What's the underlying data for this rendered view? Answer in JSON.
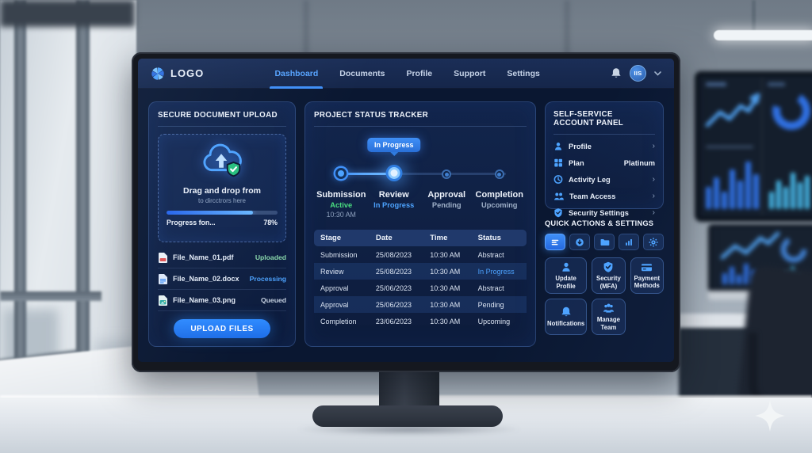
{
  "colors": {
    "accent": "#3f8ff7",
    "accent2": "#7cc4ff",
    "green": "#2ecc8f",
    "panel": "#0e1f40",
    "panelBorder": "#3a5b94",
    "screenbg": "#0a1731",
    "navbg": "#16284e",
    "text": "#eef3fb",
    "muted": "#93a7c4",
    "rowAlt": "#1a3160",
    "stUploaded": "#8ad8ac",
    "stProcessing": "#4da3ff",
    "stQueued": "#c7d2e2"
  },
  "nav": {
    "logo": "LOGO",
    "items": [
      {
        "label": "Dashboard",
        "active": true
      },
      {
        "label": "Documents",
        "active": false
      },
      {
        "label": "Profile",
        "active": false
      },
      {
        "label": "Support",
        "active": false
      },
      {
        "label": "Settings",
        "active": false
      }
    ],
    "avatar": "IIS"
  },
  "upload": {
    "title": "SECURE DOCUMENT UPLOAD",
    "dropzone_title": "Drag and drop from",
    "dropzone_subtitle": "to dircctrors here",
    "progress_label": "Progress fon...",
    "progress_percent": "78%",
    "progress_value": 78,
    "files": [
      {
        "name": "File_Name_01.pdf",
        "status": "Uploaded",
        "type": "pdf",
        "icon": "pdf-file-icon"
      },
      {
        "name": "File_Name_02.docx",
        "status": "Processing",
        "type": "docx",
        "icon": "docx-file-icon"
      },
      {
        "name": "File_Name_03.png",
        "status": "Queued",
        "type": "png",
        "icon": "png-file-icon"
      }
    ],
    "button": "UPLOAD FILES"
  },
  "tracker": {
    "title": "PROJECT STATUS TRACKER",
    "tooltip": "In Progress",
    "steps": [
      {
        "title": "Submission",
        "status": "Active",
        "time": "10:30 AM",
        "state": "done"
      },
      {
        "title": "Review",
        "status": "In Progress",
        "state": "current"
      },
      {
        "title": "Approval",
        "status": "Pending",
        "state": "upcoming"
      },
      {
        "title": "Completion",
        "status": "Upcoming",
        "state": "upcoming"
      }
    ],
    "table": {
      "headers": [
        "Stage",
        "Date",
        "Time",
        "Status"
      ],
      "rows": [
        {
          "stage": "Submission",
          "date": "25/08/2023",
          "time": "10:30 AM",
          "status": "Abstract"
        },
        {
          "stage": "Review",
          "date": "25/08/2023",
          "time": "10:30 AM",
          "status": "In Progress"
        },
        {
          "stage": "Approval",
          "date": "25/06/2023",
          "time": "10:30 AM",
          "status": "Abstract"
        },
        {
          "stage": "Approval",
          "date": "25/06/2023",
          "time": "10:30 AM",
          "status": "Pending"
        },
        {
          "stage": "Completion",
          "date": "23/06/2023",
          "time": "10:30 AM",
          "status": "Upcoming"
        }
      ]
    }
  },
  "account": {
    "title": "SELF-SERVICE ACCOUNT PANEL",
    "items": [
      {
        "label": "Profile",
        "icon": "user-icon",
        "trailing": "›"
      },
      {
        "label": "Plan",
        "icon": "grid-icon",
        "trailing": "Platinum"
      },
      {
        "label": "Activity Leg",
        "icon": "clock-icon",
        "trailing": "›"
      },
      {
        "label": "Team Access",
        "icon": "users-icon",
        "trailing": "›"
      },
      {
        "label": "Security Settings",
        "icon": "shield-icon",
        "trailing": "›"
      }
    ]
  },
  "quick": {
    "title": "QUICK ACTIONS & SETTINGS",
    "toolbar_icons": [
      "menu-icon",
      "download-icon",
      "folder-icon",
      "bar-chart-icon",
      "gear-icon"
    ],
    "cards": [
      {
        "label": "Update Profile",
        "icon": "user-icon"
      },
      {
        "label": "Security (MFA)",
        "icon": "shield-check-icon"
      },
      {
        "label": "Payment Methods",
        "icon": "credit-card-icon"
      },
      {
        "label": "Notifications",
        "icon": "bell-icon"
      },
      {
        "label": "Manage Team",
        "icon": "team-icon"
      }
    ]
  }
}
